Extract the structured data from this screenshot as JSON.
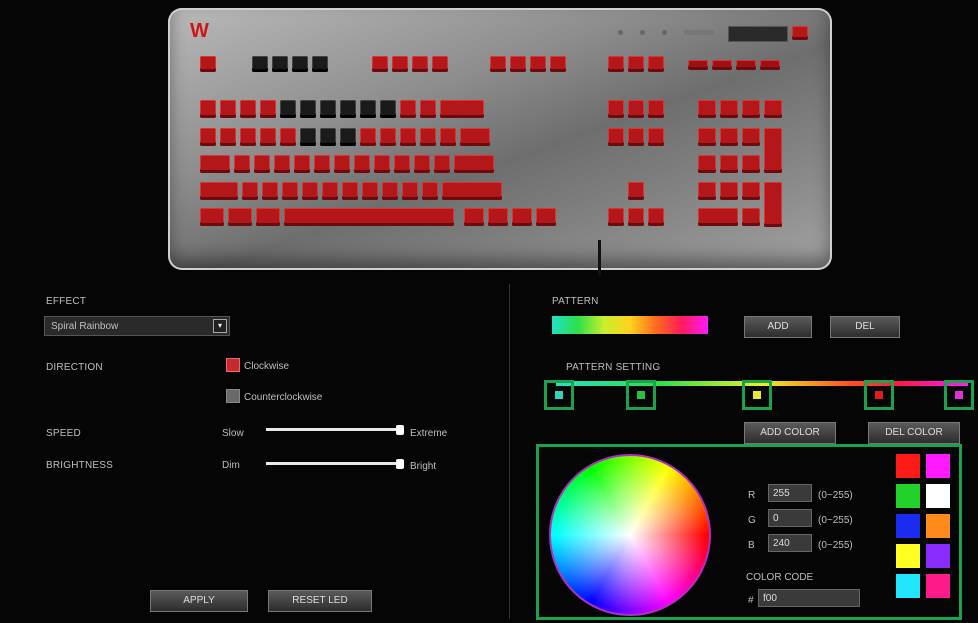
{
  "keyboard": {
    "logo": "W"
  },
  "effect": {
    "label": "EFFECT",
    "selected": "Spiral Rainbow",
    "direction_label": "DIRECTION",
    "direction_options": [
      "Clockwise",
      "Counterclockwise"
    ],
    "speed_label": "SPEED",
    "speed_min": "Slow",
    "speed_max": "Extreme",
    "speed_level": 1.0,
    "brightness_label": "BRIGHTNESS",
    "brightness_min": "Dim",
    "brightness_max": "Bright",
    "brightness_level": 1.0
  },
  "actions": {
    "apply": "APPLY",
    "reset": "RESET LED"
  },
  "pattern": {
    "label": "PATTERN",
    "add": "ADD",
    "del": "DEL",
    "setting_label": "PATTERN SETTING",
    "stop_colors": [
      "#2fd1b8",
      "#22c33a",
      "#e9e930",
      "#e11a24",
      "#e030d6"
    ],
    "add_color": "ADD COLOR",
    "del_color": "DEL COLOR"
  },
  "color_picker": {
    "r_label": "R",
    "g_label": "G",
    "b_label": "B",
    "r_value": "255",
    "g_value": "0",
    "b_value": "240",
    "range": "(0~255)",
    "code_label": "COLOR CODE",
    "hash": "#",
    "code_value": "f00",
    "swatches": [
      "#ff1a1a",
      "#ff1aff",
      "#22d22a",
      "#ffffff",
      "#1a2cf0",
      "#ff8a1a",
      "#ffff22",
      "#8a2cff",
      "#22e6ff",
      "#ff1a8a"
    ]
  }
}
